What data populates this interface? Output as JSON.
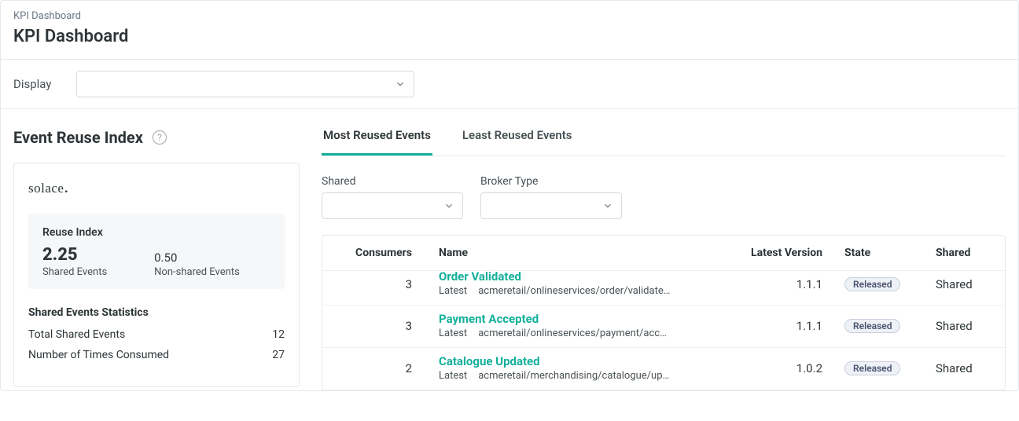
{
  "breadcrumb": "KPI Dashboard",
  "pageTitle": "KPI Dashboard",
  "displayLabel": "Display",
  "leftPanel": {
    "title": "Event Reuse Index",
    "brand": "solace",
    "metric": {
      "label": "Reuse Index",
      "sharedValue": "2.25",
      "sharedLabel": "Shared Events",
      "nonSharedValue": "0.50",
      "nonSharedLabel": "Non-shared Events"
    },
    "statsTitle": "Shared Events Statistics",
    "stats": [
      {
        "label": "Total Shared Events",
        "value": "12"
      },
      {
        "label": "Number of Times Consumed",
        "value": "27"
      }
    ]
  },
  "tabs": [
    {
      "label": "Most Reused Events",
      "active": true
    },
    {
      "label": "Least Reused Events",
      "active": false
    }
  ],
  "filters": {
    "sharedLabel": "Shared",
    "brokerLabel": "Broker Type"
  },
  "table": {
    "headers": {
      "consumers": "Consumers",
      "name": "Name",
      "version": "Latest Version",
      "state": "State",
      "shared": "Shared"
    },
    "subPrefix": "Latest",
    "rows": [
      {
        "consumers": "3",
        "name": "Order Validated",
        "path": "acmeretail/onlineservices/order/validate…",
        "version": "1.1.1",
        "state": "Released",
        "shared": "Shared",
        "cut": true
      },
      {
        "consumers": "3",
        "name": "Payment Accepted",
        "path": "acmeretail/onlineservices/payment/acc…",
        "version": "1.1.1",
        "state": "Released",
        "shared": "Shared",
        "cut": false
      },
      {
        "consumers": "2",
        "name": "Catalogue Updated",
        "path": "acmeretail/merchandising/catalogue/up…",
        "version": "1.0.2",
        "state": "Released",
        "shared": "Shared",
        "cut": false
      }
    ]
  }
}
